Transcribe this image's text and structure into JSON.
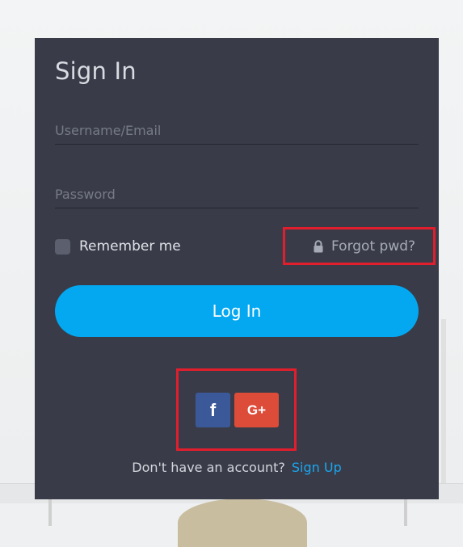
{
  "form": {
    "title": "Sign In",
    "username_placeholder": "Username/Email",
    "password_placeholder": "Password",
    "remember_label": "Remember me",
    "forgot_label": "Forgot pwd?",
    "login_label": "Log In"
  },
  "social": {
    "facebook_label": "f",
    "google_label": "G+"
  },
  "footer": {
    "no_account_text": "Don't have an account?",
    "signup_label": "Sign Up"
  },
  "colors": {
    "card_bg": "#393c48",
    "login_button": "#03a8f1",
    "facebook": "#3b5998",
    "google": "#dd4b39",
    "signup_link": "#1aa6ef",
    "highlight": "#e21e2d"
  },
  "icons": {
    "lock": "lock-icon"
  }
}
